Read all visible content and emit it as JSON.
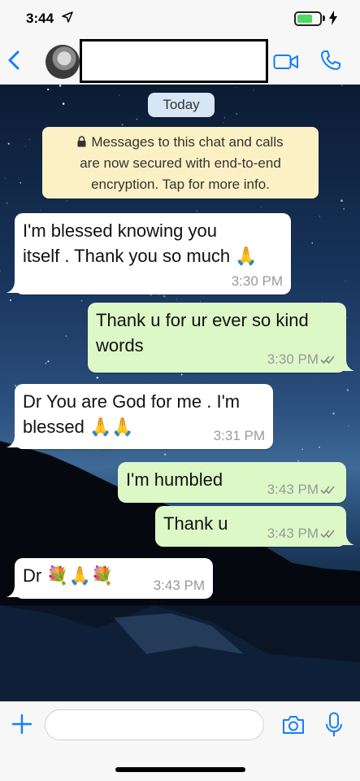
{
  "status_bar": {
    "time": "3:44",
    "battery_level": 0.7,
    "icons": [
      "location-arrow-icon",
      "battery-icon",
      "charging-bolt-icon"
    ]
  },
  "header": {
    "contact_name": "",
    "icons": [
      "chevron-left-icon",
      "avatar",
      "video-camera-icon",
      "phone-icon"
    ],
    "accent_color": "#147efb"
  },
  "chat": {
    "date_label": "Today",
    "encryption_notice": {
      "line1": "Messages to this chat and calls",
      "line2": "are now secured with end-to-end",
      "line3": "encryption. Tap for more info."
    },
    "messages": [
      {
        "direction": "incoming",
        "line1": "I'm blessed knowing you",
        "line2": "itself . Thank you so much 🙏",
        "time": "3:30 PM"
      },
      {
        "direction": "outgoing",
        "line1": "Thank u for ur ever so kind",
        "line2": "words",
        "time": "3:30 PM",
        "status": "read-ticks"
      },
      {
        "direction": "incoming",
        "line1": "Dr You are God for me . I'm",
        "line2": "blessed 🙏🙏",
        "time": "3:31 PM"
      },
      {
        "direction": "outgoing",
        "text": "I'm humbled",
        "time": "3:43 PM",
        "status": "read-ticks"
      },
      {
        "direction": "outgoing",
        "text": "Thank u",
        "time": "3:43 PM",
        "status": "read-ticks"
      },
      {
        "direction": "incoming",
        "text": "Dr 💐🙏💐",
        "time": "3:43 PM"
      }
    ],
    "colors": {
      "incoming_bubble": "#ffffff",
      "outgoing_bubble": "#dcf8c6",
      "notice_bubble": "#fcf1c4",
      "date_pill": "#d6e6f5"
    }
  },
  "input_bar": {
    "placeholder": "",
    "icons": [
      "plus-icon",
      "camera-icon",
      "microphone-icon"
    ]
  }
}
